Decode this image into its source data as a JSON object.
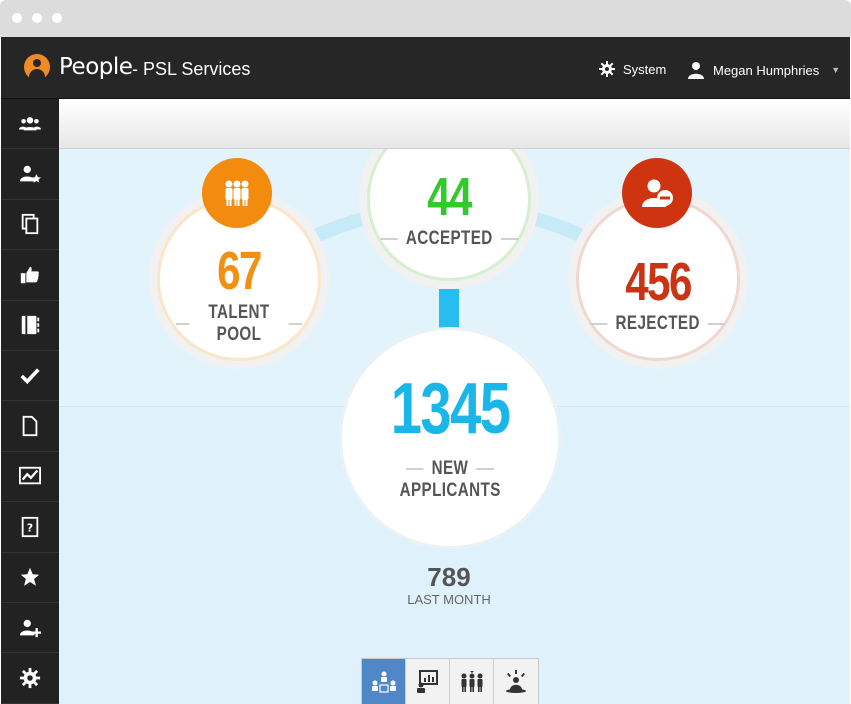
{
  "header": {
    "app_name": "People",
    "app_subtitle": "- PSL Services",
    "system_label": "System",
    "user_name": "Megan Humphries"
  },
  "sidebar": {
    "items": [
      {
        "icon": "users-icon"
      },
      {
        "icon": "user-star-icon"
      },
      {
        "icon": "documents-icon"
      },
      {
        "icon": "thumbs-up-icon"
      },
      {
        "icon": "notebook-icon"
      },
      {
        "icon": "checkmark-icon"
      },
      {
        "icon": "file-icon"
      },
      {
        "icon": "chart-icon"
      },
      {
        "icon": "help-document-icon"
      },
      {
        "icon": "star-icon"
      },
      {
        "icon": "add-user-icon"
      },
      {
        "icon": "gear-icon"
      }
    ]
  },
  "stats": {
    "talent_pool": {
      "value": "67",
      "label": "TALENT POOL",
      "color": "#f29111"
    },
    "accepted": {
      "value": "44",
      "label": "ACCEPTED",
      "color": "#33c82c"
    },
    "rejected": {
      "value": "456",
      "label": "REJECTED",
      "color": "#c83414"
    },
    "new_applicants": {
      "value": "1345",
      "label_line1": "NEW",
      "label_line2": "APPLICANTS",
      "color": "#1bb6e8"
    }
  },
  "last_month": {
    "value": "789",
    "label": "LAST MONTH"
  },
  "tabs": [
    {
      "icon": "org-chart-icon",
      "active": true
    },
    {
      "icon": "presentation-icon",
      "active": false
    },
    {
      "icon": "group-icon",
      "active": false
    },
    {
      "icon": "spotlight-person-icon",
      "active": false
    }
  ],
  "colors": {
    "header_bg": "#262626",
    "main_bg": "#e3f3fb",
    "connector": "#b9e4f5",
    "active_tab": "#4f87c8"
  }
}
